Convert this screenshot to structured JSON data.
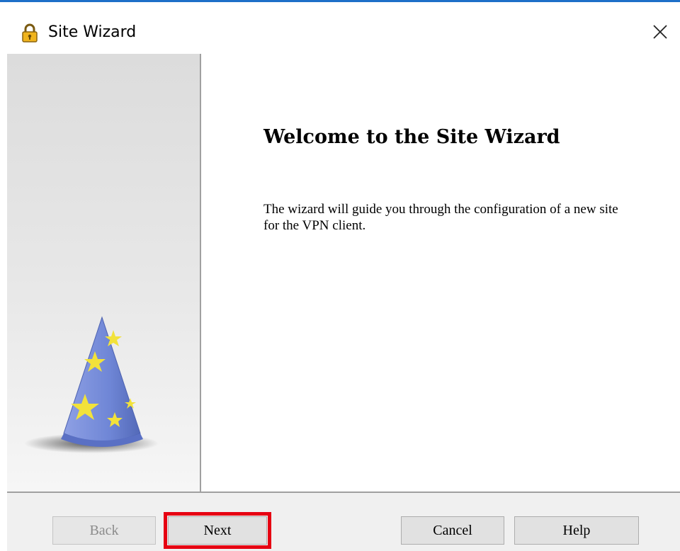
{
  "window": {
    "title": "Site Wizard",
    "icon": "lock-icon",
    "close_icon": "close-icon"
  },
  "sidebar": {
    "illustration": "wizard-hat-icon"
  },
  "content": {
    "heading": "Welcome to the Site Wizard",
    "description": "The wizard will guide you through the configuration of a new site for the VPN client."
  },
  "buttons": {
    "back": {
      "label": "Back",
      "enabled": false
    },
    "next": {
      "label": "Next",
      "enabled": true,
      "highlighted": true
    },
    "cancel": {
      "label": "Cancel",
      "enabled": true
    },
    "help": {
      "label": "Help",
      "enabled": true
    }
  },
  "colors": {
    "title_accent": "#1e6fc8",
    "highlight": "#e60012",
    "hat_blue": "#6f86d6",
    "hat_star": "#f2e23a"
  }
}
